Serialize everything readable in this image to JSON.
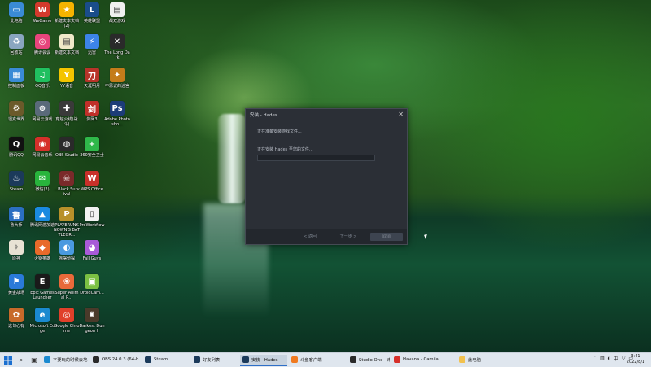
{
  "desktop": {
    "icons": [
      {
        "label": "此电脑",
        "icon": "pc-icon",
        "color": "#3a8bd6",
        "glyph": "▭"
      },
      {
        "label": "WeGame",
        "icon": "wegame-icon",
        "color": "#d33a2c",
        "glyph": "W"
      },
      {
        "label": "新建文本文档 (2)",
        "icon": "star-icon",
        "color": "#f5b400",
        "glyph": "★"
      },
      {
        "label": "英雄联盟",
        "icon": "lol-icon",
        "color": "#1a4d8a",
        "glyph": "L"
      },
      {
        "label": "战双游戏",
        "icon": "document-icon",
        "color": "#f0f0f0",
        "glyph": "▤"
      },
      {
        "label": "回收站",
        "icon": "recycle-bin-icon",
        "color": "#8aa6c0",
        "glyph": "♻"
      },
      {
        "label": "腾讯会议",
        "icon": "meeting-icon",
        "color": "#e8457c",
        "glyph": "◎"
      },
      {
        "label": "新建文本文档",
        "icon": "text-file-icon",
        "color": "#efe9c8",
        "glyph": "▤"
      },
      {
        "label": "迅雷",
        "icon": "thunder-icon",
        "color": "#3c84e8",
        "glyph": "⚡"
      },
      {
        "label": "The Long Dark",
        "icon": "longdark-icon",
        "color": "#2a2a2a",
        "glyph": "✕"
      },
      {
        "label": "控制面板",
        "icon": "control-panel-icon",
        "color": "#3a8bd6",
        "glyph": "▦"
      },
      {
        "label": "QQ音乐",
        "icon": "qq-music-icon",
        "color": "#20c060",
        "glyph": "♫"
      },
      {
        "label": "YY语音",
        "icon": "yy-icon",
        "color": "#f4c400",
        "glyph": "Y"
      },
      {
        "label": "天涯明月",
        "icon": "game-icon",
        "color": "#b8342a",
        "glyph": "刀"
      },
      {
        "label": "不思议的迷宫",
        "icon": "game-icon-2",
        "color": "#c47c1a",
        "glyph": "✦"
      },
      {
        "label": "坦克世界",
        "icon": "tank-icon",
        "color": "#6b5a2a",
        "glyph": "⚙"
      },
      {
        "label": "网易云游戏",
        "icon": "cloud-game-icon",
        "color": "#5a6a7a",
        "glyph": "⊕"
      },
      {
        "label": "穿越火线(战斗)",
        "icon": "cf-icon",
        "color": "#3a3a3a",
        "glyph": "✚"
      },
      {
        "label": "剑网3",
        "icon": "jx3-icon",
        "color": "#c0302a",
        "glyph": "剑"
      },
      {
        "label": "Adobe Photosho...",
        "icon": "photoshop-icon",
        "color": "#1c3c78",
        "glyph": "Ps"
      },
      {
        "label": "腾讯QQ",
        "icon": "qq-icon",
        "color": "#111111",
        "glyph": "Q"
      },
      {
        "label": "网易云音乐",
        "icon": "netease-music-icon",
        "color": "#d6302a",
        "glyph": "◉"
      },
      {
        "label": "OBS Studio",
        "icon": "obs-icon",
        "color": "#2a2a2a",
        "glyph": "◍"
      },
      {
        "label": "360安全卫士",
        "icon": "360-icon",
        "color": "#2fb84a",
        "glyph": "+"
      },
      {
        "label": "Steam",
        "icon": "steam-icon",
        "color": "#1b3a5a",
        "glyph": "♨"
      },
      {
        "label": "微信(2)",
        "icon": "wechat-icon",
        "color": "#28b43c",
        "glyph": "✉"
      },
      {
        "label": "...Black Survival",
        "icon": "blacksurvival-icon",
        "color": "#7a2a2a",
        "glyph": "☠"
      },
      {
        "label": "WPS Office",
        "icon": "wps-icon",
        "color": "#c8302a",
        "glyph": "W"
      },
      {
        "label": "鲁大师",
        "icon": "ludashi-icon",
        "color": "#2b6fc2",
        "glyph": "鲁"
      },
      {
        "label": "腾讯网游加速",
        "icon": "accelerator-icon",
        "color": "#1a8ae0",
        "glyph": "▲"
      },
      {
        "label": "PLAYERUNKNOWN'S BATTLEGR...",
        "icon": "pubg-icon",
        "color": "#b8902a",
        "glyph": "P"
      },
      {
        "label": "ProWorkflow",
        "icon": "file-icon",
        "color": "#f2f2f2",
        "glyph": "▯"
      },
      {
        "label": "原神",
        "icon": "genshin-icon",
        "color": "#e8e2d4",
        "glyph": "✧"
      },
      {
        "label": "火锅英雄",
        "icon": "hotpot-icon",
        "color": "#e86a2a",
        "glyph": "◆"
      },
      {
        "label": "摇摆侦探",
        "icon": "bilibili-icon",
        "color": "#4a9ae0",
        "glyph": "◐"
      },
      {
        "label": "Fall Guys",
        "icon": "fallguys-icon",
        "color": "#a85ad8",
        "glyph": "◕"
      },
      {
        "label": "黄金战场",
        "icon": "app-icon",
        "color": "#2a7ad8",
        "glyph": "⚑"
      },
      {
        "label": "Epic Games Launcher",
        "icon": "epic-icon",
        "color": "#1a1a1a",
        "glyph": "E"
      },
      {
        "label": "Super Animal R...",
        "icon": "superanimal-icon",
        "color": "#e86a3a",
        "glyph": "❀"
      },
      {
        "label": "DroidCam...",
        "icon": "droidcam-icon",
        "color": "#7bc043",
        "glyph": "▣"
      },
      {
        "label": "这句心有",
        "icon": "misc-icon",
        "color": "#c86a2a",
        "glyph": "✿"
      },
      {
        "label": "Microsoft Edge",
        "icon": "edge-icon",
        "color": "#1a8ad0",
        "glyph": "e"
      },
      {
        "label": "Google Chrome",
        "icon": "chrome-icon",
        "color": "#e0402a",
        "glyph": "◎"
      },
      {
        "label": "Darkest Dungeon II",
        "icon": "darkest-icon",
        "color": "#4a3a2a",
        "glyph": "♜"
      }
    ]
  },
  "dialog": {
    "title": "安装 - Hades",
    "line1": "正在准备安装游戏文件...",
    "line2": "正在安装 Hades 至您的文件...",
    "progress_fraction": 0,
    "back_label": "< 返回",
    "next_label": "下一步 >",
    "cancel_label": "取消"
  },
  "taskbar": {
    "tasks": [
      {
        "label": "不要玩的时候去地",
        "icon": "edge-icon",
        "color": "#1a8ad0",
        "active": false
      },
      {
        "label": "OBS 24.0.3 (64-b...",
        "icon": "obs-icon",
        "color": "#2a2a2a",
        "active": false
      },
      {
        "label": "Steam",
        "icon": "steam-icon",
        "color": "#1b3a5a",
        "active": false
      },
      {
        "label": "好友列表",
        "icon": "steam-icon",
        "color": "#1b3a5a",
        "active": false
      },
      {
        "label": "安装 - Hades",
        "icon": "steam-icon",
        "color": "#1b3a5a",
        "active": true
      },
      {
        "label": "斗鱼客户端",
        "icon": "douyu-icon",
        "color": "#f07a20",
        "active": false
      },
      {
        "label": "Studio One - 未...",
        "icon": "studio-one-icon",
        "color": "#2a2a2a",
        "active": false
      },
      {
        "label": "Havana - Camila...",
        "icon": "netease-music-icon",
        "color": "#d6302a",
        "active": false
      },
      {
        "label": "此电脑",
        "icon": "folder-icon",
        "color": "#f2c14e",
        "active": false
      }
    ],
    "tray_icons": [
      "chevron-up-icon",
      "network-icon",
      "volume-icon",
      "input-icon",
      "shield-icon",
      "battery-icon"
    ],
    "time": "3:41",
    "date": "2022/8/1"
  }
}
